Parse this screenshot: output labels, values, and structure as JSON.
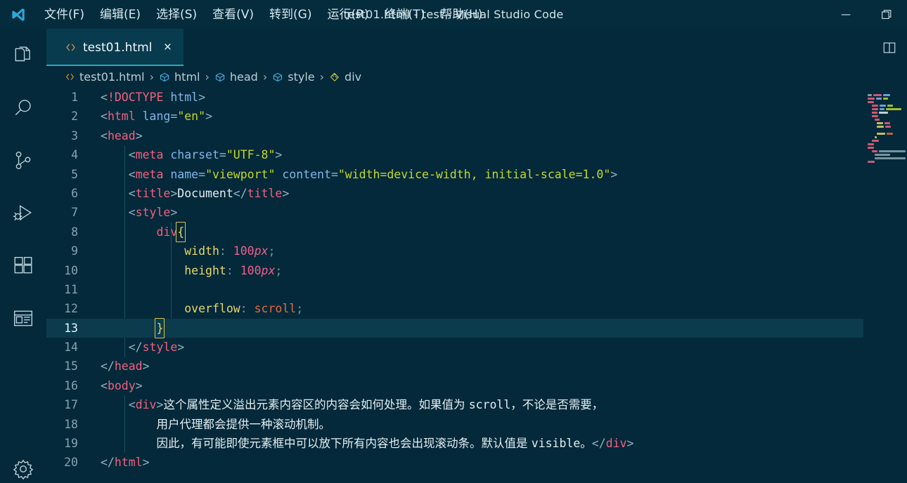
{
  "window": {
    "title": "test01.html - test - Visual Studio Code",
    "minimize_label": "minimize",
    "restore_label": "restore"
  },
  "menubar": {
    "items": [
      {
        "label": "文件(F)",
        "name": "menu-file"
      },
      {
        "label": "编辑(E)",
        "name": "menu-edit"
      },
      {
        "label": "选择(S)",
        "name": "menu-selection"
      },
      {
        "label": "查看(V)",
        "name": "menu-view"
      },
      {
        "label": "转到(G)",
        "name": "menu-go"
      },
      {
        "label": "运行(R)",
        "name": "menu-run"
      },
      {
        "label": "终端(T)",
        "name": "menu-terminal"
      },
      {
        "label": "帮助(H)",
        "name": "menu-help"
      }
    ]
  },
  "activitybar": {
    "items": [
      {
        "icon": "files-icon",
        "label": "资源管理器"
      },
      {
        "icon": "search-icon",
        "label": "搜索"
      },
      {
        "icon": "source-control-icon",
        "label": "源代码管理"
      },
      {
        "icon": "run-debug-icon",
        "label": "运行和调试"
      },
      {
        "icon": "extensions-icon",
        "label": "扩展"
      },
      {
        "icon": "browser-preview-icon",
        "label": "浏览器预览"
      }
    ],
    "bottom": [
      {
        "icon": "gear-icon",
        "label": "管理"
      }
    ]
  },
  "tabs": [
    {
      "label": "test01.html",
      "icon": "html-file-icon",
      "close": "×",
      "active": true
    }
  ],
  "tabbar_actions": [
    {
      "icon": "split-editor-icon",
      "label": "拆分编辑器"
    }
  ],
  "breadcrumb": [
    {
      "label": "test01.html",
      "icon": "html-file-icon"
    },
    {
      "label": "html",
      "icon": "symbol-field-icon"
    },
    {
      "label": "head",
      "icon": "symbol-field-icon"
    },
    {
      "label": "style",
      "icon": "symbol-field-icon"
    },
    {
      "label": "div",
      "icon": "symbol-ruler-icon"
    }
  ],
  "breadcrumb_separator": "›",
  "editor": {
    "current_line": 13,
    "line_numbers": [
      1,
      2,
      3,
      4,
      5,
      6,
      7,
      8,
      9,
      10,
      11,
      12,
      13,
      14,
      15,
      16,
      17,
      18,
      19,
      20
    ],
    "lines": [
      {
        "n": 1,
        "text": "<!DOCTYPE html>"
      },
      {
        "n": 2,
        "text": "<html lang=\"en\">"
      },
      {
        "n": 3,
        "text": "<head>"
      },
      {
        "n": 4,
        "text": "    <meta charset=\"UTF-8\">"
      },
      {
        "n": 5,
        "text": "    <meta name=\"viewport\" content=\"width=device-width, initial-scale=1.0\">"
      },
      {
        "n": 6,
        "text": "    <title>Document</title>"
      },
      {
        "n": 7,
        "text": "    <style>"
      },
      {
        "n": 8,
        "text": "        div{"
      },
      {
        "n": 9,
        "text": "            width: 100px;"
      },
      {
        "n": 10,
        "text": "            height: 100px;"
      },
      {
        "n": 11,
        "text": ""
      },
      {
        "n": 12,
        "text": "            overflow: scroll;"
      },
      {
        "n": 13,
        "text": "        }"
      },
      {
        "n": 14,
        "text": "    </style>"
      },
      {
        "n": 15,
        "text": "</head>"
      },
      {
        "n": 16,
        "text": "<body>"
      },
      {
        "n": 17,
        "text": "    <div>这个属性定义溢出元素内容区的内容会如何处理。如果值为 scroll，不论是否需要，"
      },
      {
        "n": 18,
        "text": "        用户代理都会提供一种滚动机制。"
      },
      {
        "n": 19,
        "text": "        因此，有可能即使元素框中可以放下所有内容也会出现滚动条。默认值是 visible。</div>"
      },
      {
        "n": 20,
        "text": "</html>"
      }
    ]
  },
  "colors": {
    "editor_bg": "#04293a",
    "titlebar_bg": "#042c3c",
    "tab_active_bg": "#083b4e",
    "tab_accent": "#2aa8b8",
    "current_line_bg": "#0b3c4e",
    "tag": "#f2607f",
    "attribute": "#82b7ea",
    "string": "#c3d82c",
    "property": "#e8d66b",
    "number": "#ef5f8c",
    "value": "#e06c3f",
    "line_number": "#7fa6b2"
  }
}
